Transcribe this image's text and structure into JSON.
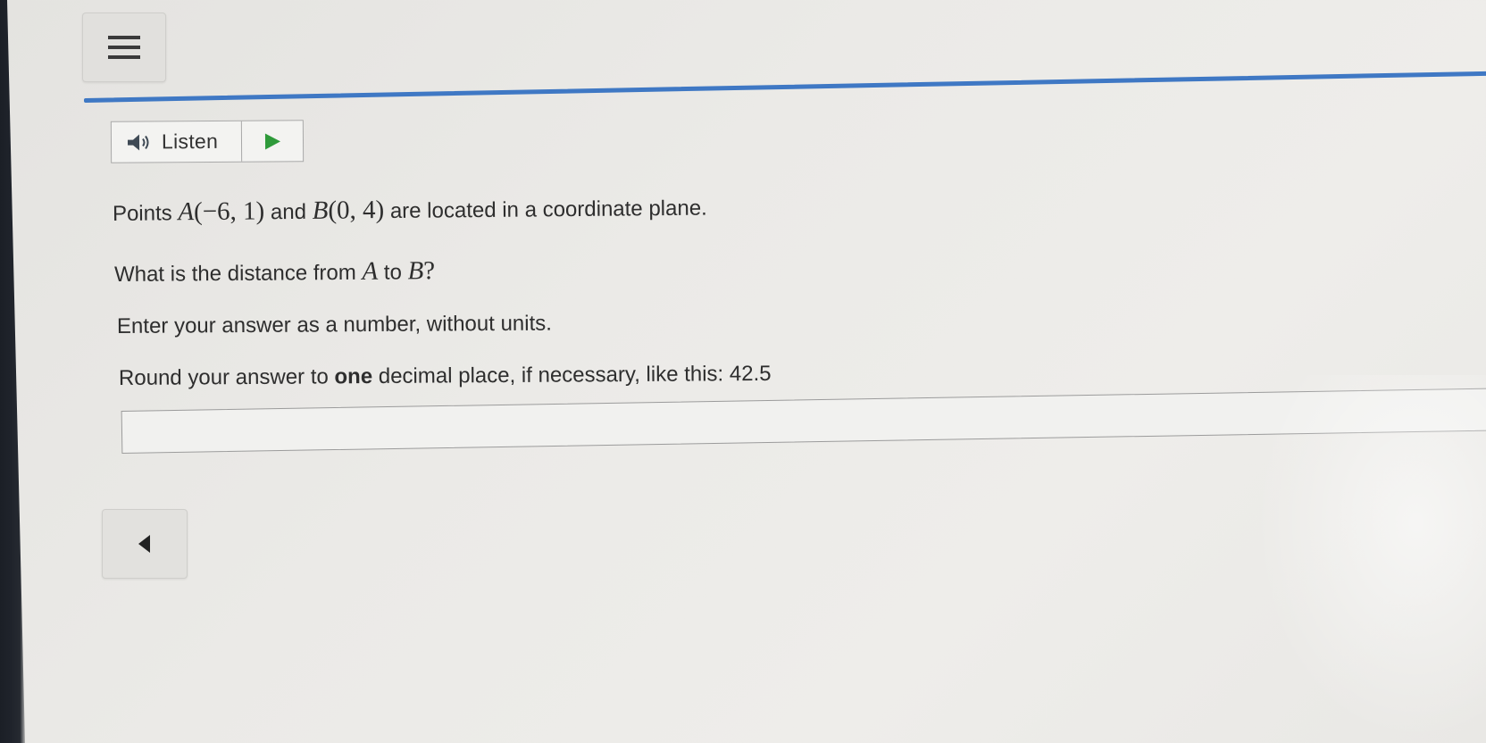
{
  "toolbar": {
    "menu_icon": "hamburger-menu-icon"
  },
  "listen": {
    "label": "Listen",
    "speaker_icon": "speaker-icon",
    "play_icon": "play-triangle-icon"
  },
  "question": {
    "line1_prefix": "Points ",
    "pointA_name": "A",
    "pointA_coords": "(−6, 1)",
    "line1_mid": " and ",
    "pointB_name": "B",
    "pointB_coords": "(0, 4)",
    "line1_suffix": " are located in a coordinate plane.",
    "line2_prefix": "What is the distance from ",
    "line2_from": "A",
    "line2_mid": " to ",
    "line2_to": "B",
    "line2_suffix": "?",
    "line3": "Enter your answer as a number, without units.",
    "line4_prefix": "Round your answer to ",
    "line4_bold": "one",
    "line4_suffix": " decimal place, if necessary, like this: 42.5"
  },
  "answer": {
    "value": "",
    "placeholder": ""
  },
  "navigation": {
    "back_icon": "left-triangle-icon"
  },
  "colors": {
    "accent_rule": "#3f78c4",
    "play_green": "#2e9a3a"
  }
}
